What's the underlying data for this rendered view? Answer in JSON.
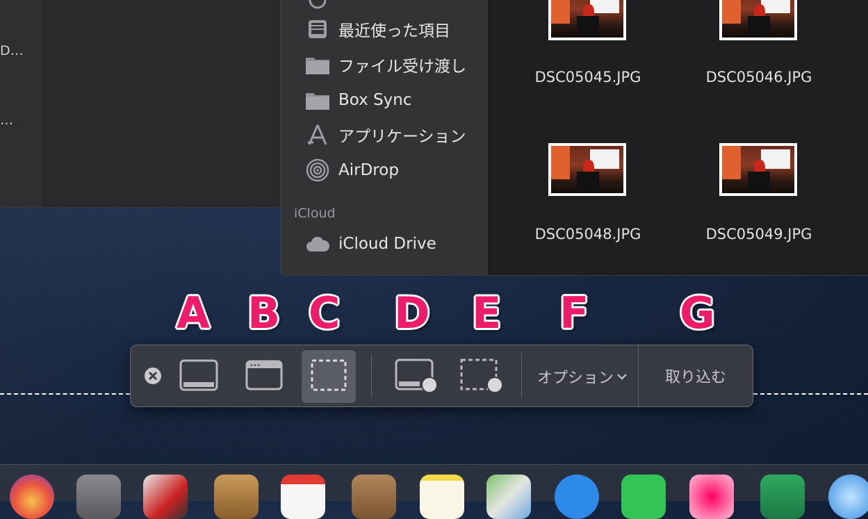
{
  "background_window": {
    "rows": [
      "D…",
      "…"
    ]
  },
  "finder": {
    "sidebar": {
      "items": [
        {
          "label": "最近使った項目",
          "icon": "recents-icon"
        },
        {
          "label": "ファイル受け渡し",
          "icon": "folder-icon"
        },
        {
          "label": "Box Sync",
          "icon": "folder-icon"
        },
        {
          "label": "アプリケーション",
          "icon": "applications-icon"
        },
        {
          "label": "AirDrop",
          "icon": "airdrop-icon"
        }
      ],
      "icloud_section": "iCloud",
      "icloud_items": [
        {
          "label": "iCloud Drive",
          "icon": "cloud-icon"
        }
      ]
    },
    "files": [
      {
        "name": "DSC05045.JPG"
      },
      {
        "name": "DSC05046.JPG"
      },
      {
        "name": "DSC05048.JPG"
      },
      {
        "name": "DSC05049.JPG"
      }
    ]
  },
  "annotations": [
    "A",
    "B",
    "C",
    "D",
    "E",
    "F",
    "G"
  ],
  "toolbar": {
    "close_icon": "close-icon",
    "capture_entire_screen_icon": "capture-screen-icon",
    "capture_window_icon": "capture-window-icon",
    "capture_selection_icon": "capture-selection-icon",
    "record_screen_icon": "record-screen-icon",
    "record_selection_icon": "record-selection-icon",
    "options_label": "オプション",
    "capture_label": "取り込む"
  },
  "colors": {
    "annotation": "#ec1c6a",
    "toolbar_bg": "#3a3c44"
  }
}
